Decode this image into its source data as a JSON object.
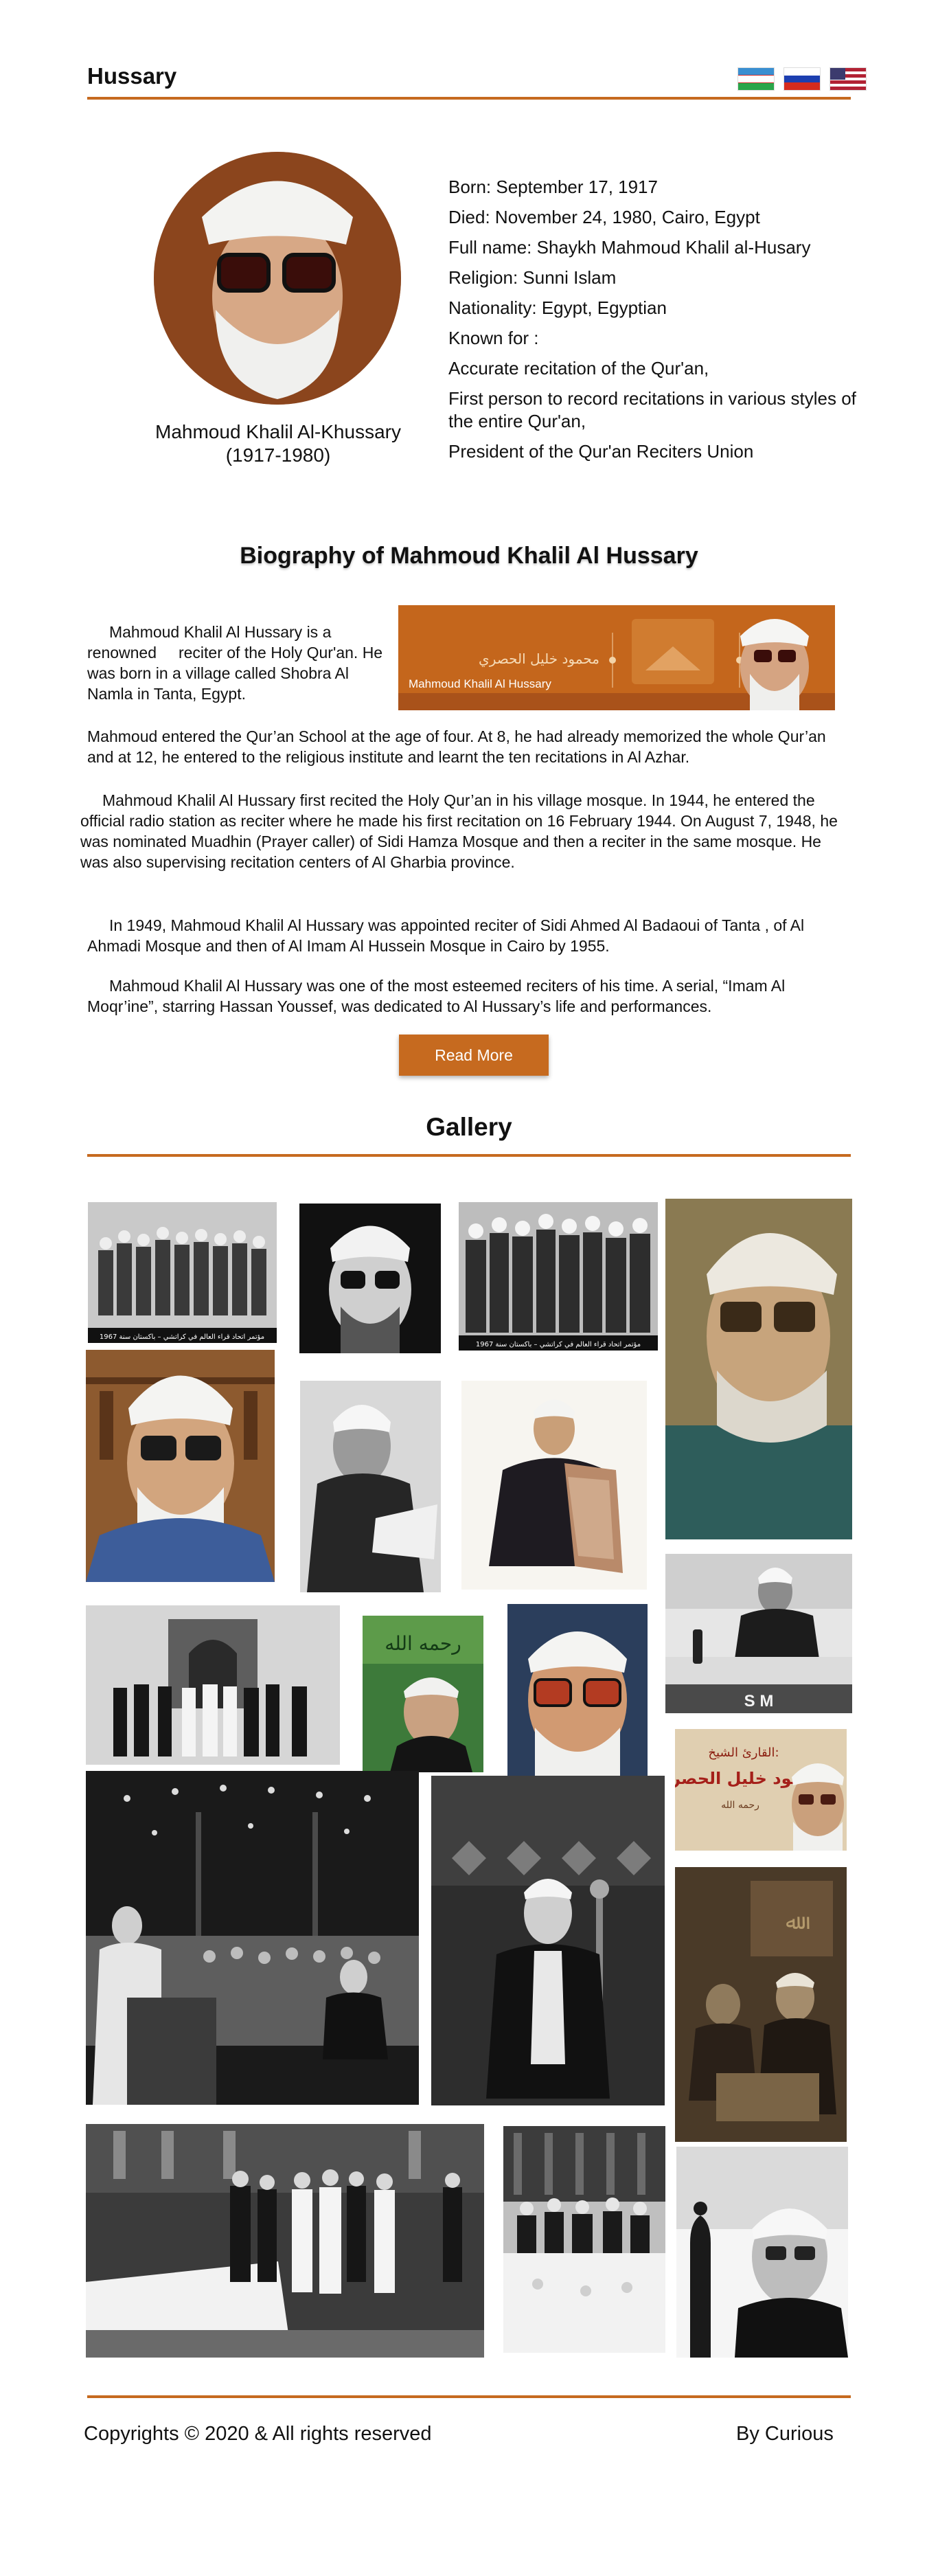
{
  "header": {
    "site_title": "Hussary",
    "flags": [
      {
        "name": "uzbekistan",
        "colors": [
          "#3a8fd1",
          "#ffffff",
          "#cf2b2b",
          "#ffffff",
          "#2aa64a"
        ]
      },
      {
        "name": "russia",
        "colors": [
          "#ffffff",
          "#1c3fb0",
          "#d52b1e"
        ]
      },
      {
        "name": "united-states",
        "colors": [
          "#b22234",
          "#ffffff",
          "#3c3b6e"
        ]
      }
    ]
  },
  "profile": {
    "caption_name": "Mahmoud Khalil Al-Khussary",
    "caption_years": "(1917-1980)",
    "facts": {
      "born": "Born: September 17, 1917",
      "died": "Died: November 24, 1980, Cairo, Egypt",
      "full_name": "Full name: Shaykh Mahmoud Khalil al-Husary",
      "religion": "Religion: Sunni Islam",
      "nationality": "Nationality:  Egypt, Egyptian",
      "known_for": "Known for :",
      "known_1": "Accurate recitation of the Qur'an,",
      "known_2": "First person to record recitations in various styles of the entire Qur'an,",
      "known_3": "President of the Qur'an Reciters Union"
    }
  },
  "biography": {
    "title": "Biography of Mahmoud Khalil Al Hussary",
    "banner_arabic": "محمود خليل الحصري",
    "banner_latin": "Mahmoud Khalil Al Hussary",
    "p1": "     Mahmoud Khalil Al Hussary is a renowned     reciter of the Holy Qur'an. He was born in a village called Shobra Al Namla in Tanta, Egypt.",
    "p2": "Mahmoud entered the Qur’an School at the age of four. At 8, he had already memorized the whole Qur’an and at 12, he entered to the religious institute and learnt the ten recitations in Al Azhar.",
    "p3": "     Mahmoud Khalil Al Hussary first recited the Holy Qur’an in his village mosque. In 1944, he entered the official radio station as reciter where he made his first recitation on 16 February 1944. On August 7, 1948, he was nominated Muadhin (Prayer caller) of Sidi Hamza Mosque and then a reciter in the same mosque. He was also supervising recitation centers of Al Gharbia province.",
    "p4": "     In 1949, Mahmoud Khalil Al Hussary was appointed reciter of Sidi Ahmed Al Badaoui of Tanta , of Al Ahmadi Mosque and then of Al Imam Al Hussein Mosque in Cairo by 1955.",
    "p5": "     Mahmoud Khalil Al Hussary was one of the most esteemed reciters of his time. A serial, “Imam Al Moqr’ine”, starring Hassan Youssef, was dedicated to Al Hussary’s life and performances.",
    "read_more": "Read More"
  },
  "gallery": {
    "title": "Gallery",
    "caption_1967_a": "مؤتمر اتحاد قراء العالم في كراتشي – باكستان سنة 1967",
    "caption_1967_b": "مؤتمر اتحاد قراء العالم في كراتشي – باكستان سنة 1967",
    "calligraphy": "رحمه الله",
    "poster_title": "القارئ الشيخ:",
    "poster_name": "محمود خليل الحصري",
    "poster_sub": "رحمه الله",
    "sign_letters": "S M"
  },
  "footer": {
    "copyright": "Copyrights © 2020 & All rights reserved",
    "by": "By Curious"
  },
  "colors": {
    "accent": "#c66a1f"
  }
}
